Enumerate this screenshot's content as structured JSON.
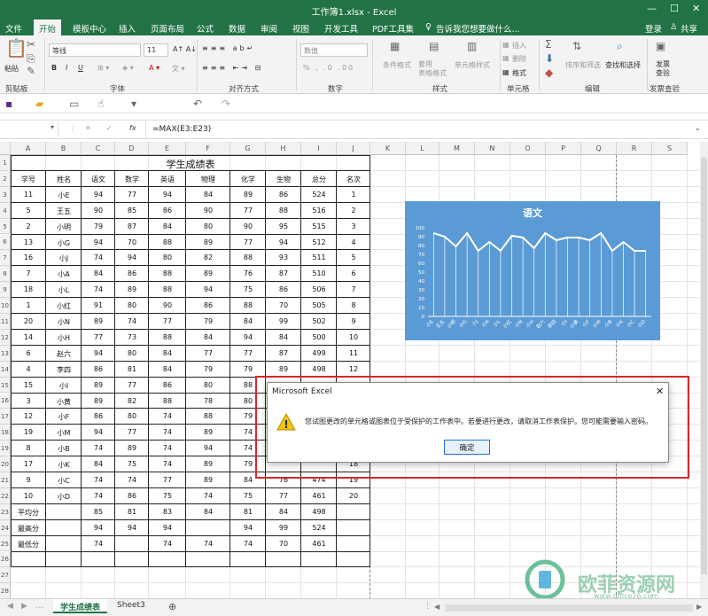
{
  "window": {
    "title": "工作簿1.xlsx - Excel"
  },
  "menu": {
    "file": "文件",
    "home": "开始",
    "template": "模板中心",
    "insert": "插入",
    "layout": "页面布局",
    "formula": "公式",
    "data": "数据",
    "review": "审阅",
    "view": "视图",
    "dev": "开发工具",
    "pdf": "PDF工具集",
    "tell": "告诉我您想要做什么...",
    "login": "登录",
    "share": "共享"
  },
  "ribbon": {
    "paste": "粘贴",
    "clipboard": "剪贴板",
    "font_name": "等线",
    "font_size": "11",
    "font_group": "字体",
    "align_group": "对齐方式",
    "num_format": "数值",
    "number_group": "数字",
    "cond_format": "条件格式",
    "table_format": "套用\n表格格式",
    "cell_style": "单元格样式",
    "styles_group": "样式",
    "insert": "插入",
    "delete": "删除",
    "format": "格式",
    "cells_group": "单元格",
    "sort": "排序和筛选",
    "find": "查找和选择",
    "edit_group": "编辑",
    "invoice": "发票\n查验",
    "invoice_group": "发票查验"
  },
  "formula_bar": {
    "name_box": "",
    "formula": "=MAX(E3:E23)"
  },
  "columns": [
    "A",
    "B",
    "C",
    "D",
    "E",
    "F",
    "G",
    "H",
    "I",
    "J",
    "K",
    "L",
    "M",
    "N",
    "O",
    "P",
    "Q",
    "R",
    "S"
  ],
  "rows": [
    "1",
    "2",
    "3",
    "4",
    "5",
    "6",
    "7",
    "8",
    "9",
    "10",
    "11",
    "12",
    "13",
    "14",
    "15",
    "16",
    "17",
    "18",
    "19",
    "20",
    "21",
    "22",
    "23",
    "24",
    "25",
    "26",
    "27",
    "28"
  ],
  "table": {
    "title": "学生成绩表",
    "headers": [
      "学号",
      "姓名",
      "语文",
      "数学",
      "英语",
      "物理",
      "化学",
      "生物",
      "总分",
      "名次"
    ],
    "data": [
      [
        "11",
        "小E",
        "94",
        "77",
        "94",
        "84",
        "89",
        "86",
        "524",
        "1"
      ],
      [
        "5",
        "王五",
        "90",
        "85",
        "86",
        "90",
        "77",
        "88",
        "516",
        "2"
      ],
      [
        "2",
        "小明",
        "79",
        "87",
        "84",
        "80",
        "90",
        "95",
        "515",
        "3"
      ],
      [
        "13",
        "小G",
        "94",
        "70",
        "88",
        "89",
        "77",
        "94",
        "512",
        "4"
      ],
      [
        "16",
        "小J",
        "74",
        "94",
        "80",
        "82",
        "88",
        "93",
        "511",
        "5"
      ],
      [
        "7",
        "小A",
        "84",
        "86",
        "88",
        "89",
        "76",
        "87",
        "510",
        "6"
      ],
      [
        "18",
        "小L",
        "74",
        "89",
        "88",
        "94",
        "75",
        "86",
        "506",
        "7"
      ],
      [
        "1",
        "小红",
        "91",
        "80",
        "90",
        "86",
        "88",
        "70",
        "505",
        "8"
      ],
      [
        "20",
        "小N",
        "89",
        "74",
        "77",
        "79",
        "84",
        "99",
        "502",
        "9"
      ],
      [
        "14",
        "小H",
        "77",
        "73",
        "88",
        "84",
        "94",
        "84",
        "500",
        "10"
      ],
      [
        "6",
        "赵六",
        "94",
        "80",
        "84",
        "77",
        "77",
        "87",
        "499",
        "11"
      ],
      [
        "4",
        "李四",
        "86",
        "81",
        "84",
        "79",
        "79",
        "89",
        "498",
        "12"
      ],
      [
        "15",
        "小I",
        "89",
        "77",
        "86",
        "80",
        "88",
        "",
        "",
        "13"
      ],
      [
        "3",
        "小黄",
        "89",
        "82",
        "88",
        "78",
        "80",
        "",
        "",
        "14"
      ],
      [
        "12",
        "小F",
        "86",
        "80",
        "74",
        "88",
        "79",
        "",
        "",
        "15"
      ],
      [
        "19",
        "小M",
        "94",
        "77",
        "74",
        "89",
        "74",
        "",
        "",
        "16"
      ],
      [
        "8",
        "小B",
        "74",
        "89",
        "74",
        "94",
        "74",
        "",
        "",
        "17"
      ],
      [
        "17",
        "小K",
        "84",
        "75",
        "74",
        "89",
        "79",
        "",
        "",
        "18"
      ],
      [
        "9",
        "小C",
        "74",
        "74",
        "77",
        "89",
        "84",
        "76",
        "474",
        "19"
      ],
      [
        "10",
        "小D",
        "74",
        "86",
        "75",
        "74",
        "75",
        "77",
        "461",
        "20"
      ],
      [
        "平均分",
        "",
        "85",
        "81",
        "83",
        "84",
        "81",
        "84",
        "498",
        ""
      ],
      [
        "最高分",
        "",
        "94",
        "94",
        "94",
        "",
        "94",
        "99",
        "524",
        ""
      ],
      [
        "最低分",
        "",
        "74",
        "",
        "74",
        "74",
        "74",
        "70",
        "461",
        ""
      ]
    ]
  },
  "chart_data": {
    "type": "line",
    "title": "语文",
    "categories": [
      "小E",
      "王五",
      "小明",
      "小G",
      "小J",
      "小A",
      "小L",
      "小红",
      "小N",
      "小H",
      "赵六",
      "李四",
      "小I",
      "小黄",
      "小F",
      "小M",
      "小B",
      "小K",
      "小C",
      "小D"
    ],
    "series": [
      {
        "values": [
          94,
          90,
          79,
          94,
          74,
          84,
          74,
          91,
          89,
          77,
          94,
          86,
          89,
          89,
          86,
          94,
          74,
          84,
          74,
          74
        ]
      }
    ],
    "ylim": [
      0,
      100
    ],
    "yticks": [
      "100",
      "90",
      "80",
      "70",
      "60",
      "50",
      "40",
      "30",
      "20",
      "10",
      "0"
    ],
    "color": "#ffffff",
    "background": "#5b9bd5"
  },
  "dialog": {
    "title": "Microsoft Excel",
    "message": "您试图更改的单元格或图表位于受保护的工作表中。若要进行更改，请取消工作表保护。您可能需要输入密码。",
    "ok": "确定"
  },
  "sheets": {
    "active": "学生成绩表",
    "other": "Sheet3"
  },
  "watermark": {
    "text": "欧菲资源网",
    "url": "www.office26.com"
  }
}
